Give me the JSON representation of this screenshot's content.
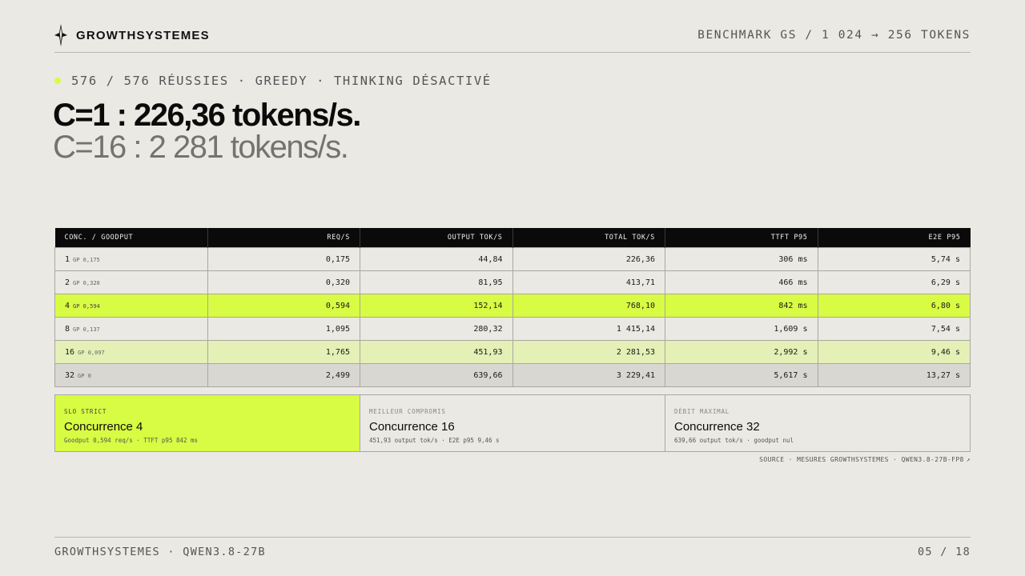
{
  "header": {
    "brand": "GROWTHSYSTEMES",
    "logo_icon": "compass-star-icon",
    "right_text": "BENCHMARK GS / 1 024 → 256 TOKENS"
  },
  "status": {
    "text": "576 / 576 RÉUSSIES · GREEDY · THINKING DÉSACTIVÉ",
    "dot_color": "#d7fd43"
  },
  "headline": {
    "primary": "C=1 : 226,36 tokens/s.",
    "secondary": "C=16 : 2 281 tokens/s."
  },
  "table": {
    "columns": [
      "CONC. / GOODPUT",
      "REQ/S",
      "OUTPUT TOK/S",
      "TOTAL TOK/S",
      "TTFT P95",
      "E2E P95"
    ],
    "rows": [
      {
        "conc": "1",
        "gp": "GP 0,175",
        "req": "0,175",
        "output": "44,84",
        "total": "226,36",
        "ttft": "306 ms",
        "e2e": "5,74 s",
        "style": "plain"
      },
      {
        "conc": "2",
        "gp": "GP 0,320",
        "req": "0,320",
        "output": "81,95",
        "total": "413,71",
        "ttft": "466 ms",
        "e2e": "6,29 s",
        "style": "plain"
      },
      {
        "conc": "4",
        "gp": "GP 0,594",
        "req": "0,594",
        "output": "152,14",
        "total": "768,10",
        "ttft": "842 ms",
        "e2e": "6,80 s",
        "style": "hl"
      },
      {
        "conc": "8",
        "gp": "GP 0,137",
        "req": "1,095",
        "output": "280,32",
        "total": "1 415,14",
        "ttft": "1,609 s",
        "e2e": "7,54 s",
        "style": "plain"
      },
      {
        "conc": "16",
        "gp": "GP 0,097",
        "req": "1,765",
        "output": "451,93",
        "total": "2 281,53",
        "ttft": "2,992 s",
        "e2e": "9,46 s",
        "style": "soft"
      },
      {
        "conc": "32",
        "gp": "GP 0",
        "req": "2,499",
        "output": "639,66",
        "total": "3 229,41",
        "ttft": "5,617 s",
        "e2e": "13,27 s",
        "style": "grey"
      }
    ]
  },
  "cards": [
    {
      "kicker": "SLO STRICT",
      "title": "Concurrence 4",
      "sub": "Goodput 0,594 req/s · TTFT p95 842 ms"
    },
    {
      "kicker": "MEILLEUR COMPROMIS",
      "title": "Concurrence 16",
      "sub": "451,93 output tok/s · E2E p95 9,46 s"
    },
    {
      "kicker": "DÉBIT MAXIMAL",
      "title": "Concurrence 32",
      "sub": "639,66 output tok/s · goodput nul"
    }
  ],
  "source": {
    "text": "SOURCE · MESURES GROWTHSYSTEMES · QWEN3.8-27B-FP8",
    "arrow": "↗"
  },
  "footer": {
    "left": "GROWTHSYSTEMES · QWEN3.8-27B",
    "right": "05 / 18"
  },
  "colors": {
    "accent": "#d8fb43",
    "accent_soft": "#e4f0b5",
    "background": "#ebe9e4",
    "header_bg": "#0a0a0a"
  }
}
